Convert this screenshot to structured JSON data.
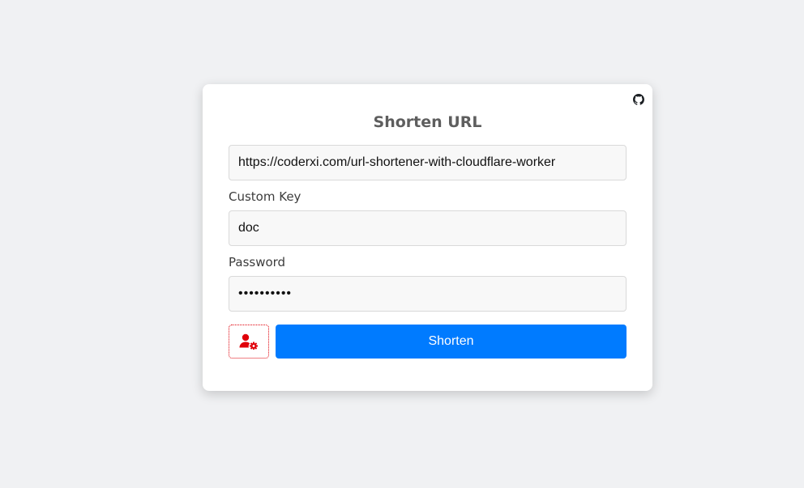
{
  "card": {
    "title": "Shorten URL",
    "github_icon": "github-icon"
  },
  "form": {
    "url": {
      "value": "https://coderxi.com/url-shortener-with-cloudflare-worker"
    },
    "custom_key": {
      "label": "Custom Key",
      "value": "doc"
    },
    "password": {
      "label": "Password",
      "value": "••••••••••"
    },
    "admin_button_icon": "user-gear-icon",
    "submit_label": "Shorten"
  },
  "colors": {
    "page_background": "#f0f1f3",
    "card_background": "#ffffff",
    "primary_button": "#007bff",
    "admin_icon": "#e0000a",
    "title_text": "#5e5e5e"
  }
}
